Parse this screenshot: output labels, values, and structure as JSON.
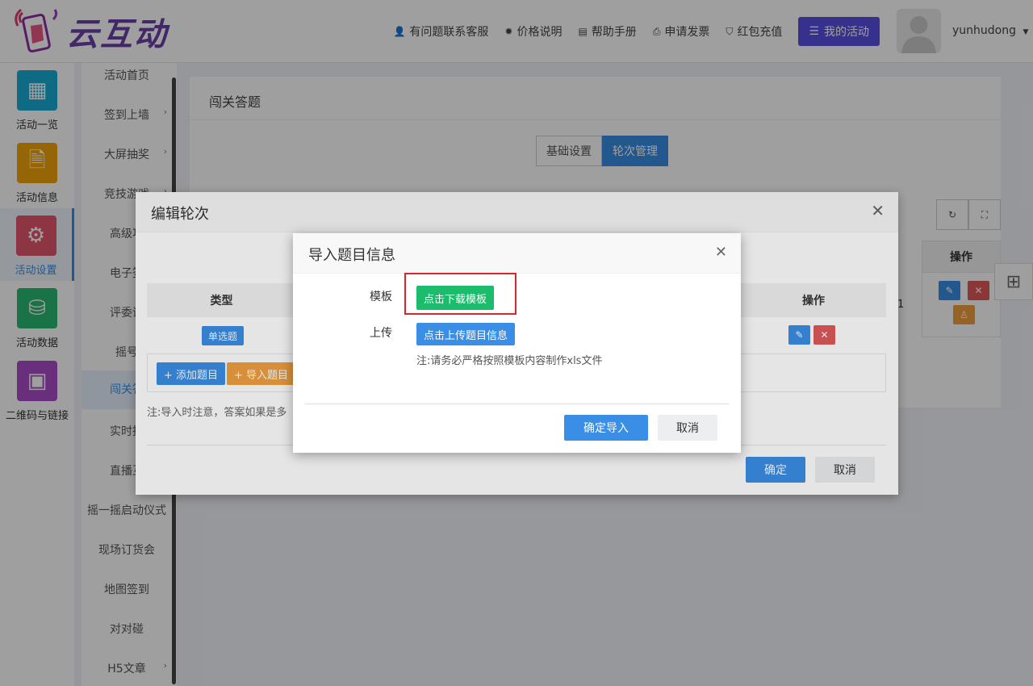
{
  "brand": {
    "name": "云互动"
  },
  "topnav": {
    "items": [
      {
        "label": "有问题联系客服",
        "icon": "user-plus-icon"
      },
      {
        "label": "价格说明",
        "icon": "badge-icon"
      },
      {
        "label": "帮助手册",
        "icon": "book-icon"
      },
      {
        "label": "申请发票",
        "icon": "printer-icon"
      },
      {
        "label": "红包充值",
        "icon": "shield-check-icon"
      }
    ],
    "my_activity": "我的活动",
    "username": "yunhudong"
  },
  "sidebar": {
    "items": [
      {
        "label": "活动一览",
        "icon": "grid-icon",
        "color": "#19a9d5"
      },
      {
        "label": "活动信息",
        "icon": "document-icon",
        "color": "#f0a30a"
      },
      {
        "label": "活动设置",
        "icon": "gear-icon",
        "color": "#e2556a",
        "active": true
      },
      {
        "label": "活动数据",
        "icon": "database-icon",
        "color": "#2bb673"
      },
      {
        "label": "二维码与链接",
        "icon": "qrcode-icon",
        "color": "#a94cc7"
      }
    ]
  },
  "submenu": {
    "items": [
      {
        "label": "活动首页",
        "arrow": false
      },
      {
        "label": "签到上墙",
        "arrow": true
      },
      {
        "label": "大屏抽奖",
        "arrow": true
      },
      {
        "label": "竞技游戏",
        "arrow": true
      },
      {
        "label": "高级功",
        "arrow": false
      },
      {
        "label": "电子签",
        "arrow": false
      },
      {
        "label": "评委评",
        "arrow": false
      },
      {
        "label": "摇号",
        "arrow": false
      },
      {
        "label": "闯关答",
        "arrow": false,
        "active": true
      },
      {
        "label": "实时投",
        "arrow": false
      },
      {
        "label": "直播互",
        "arrow": false
      },
      {
        "label": "摇一摇启动仪式",
        "arrow": false
      },
      {
        "label": "现场订货会",
        "arrow": false
      },
      {
        "label": "地图签到",
        "arrow": false
      },
      {
        "label": "对对碰",
        "arrow": false
      },
      {
        "label": "H5文章",
        "arrow": true
      }
    ]
  },
  "page": {
    "title": "闯关答题",
    "tabs": [
      "基础设置",
      "轮次管理"
    ],
    "table_header_ops": "操作",
    "row_value": "1"
  },
  "edit_modal": {
    "title": "编辑轮次",
    "col_type": "类型",
    "col_ops": "操作",
    "row_type": "单选题",
    "add_btn": "+ 添加题目",
    "import_btn": "+ 导入题目",
    "note": "注:导入时注意，答案如果是多",
    "ok": "确定",
    "cancel": "取消"
  },
  "import_modal": {
    "title": "导入题目信息",
    "template_label": "模板",
    "download_btn": "点击下载模板",
    "upload_label": "上传",
    "upload_btn": "点击上传题目信息",
    "note": "注:请务必严格按照模板内容制作xls文件",
    "confirm": "确定导入",
    "cancel": "取消"
  }
}
